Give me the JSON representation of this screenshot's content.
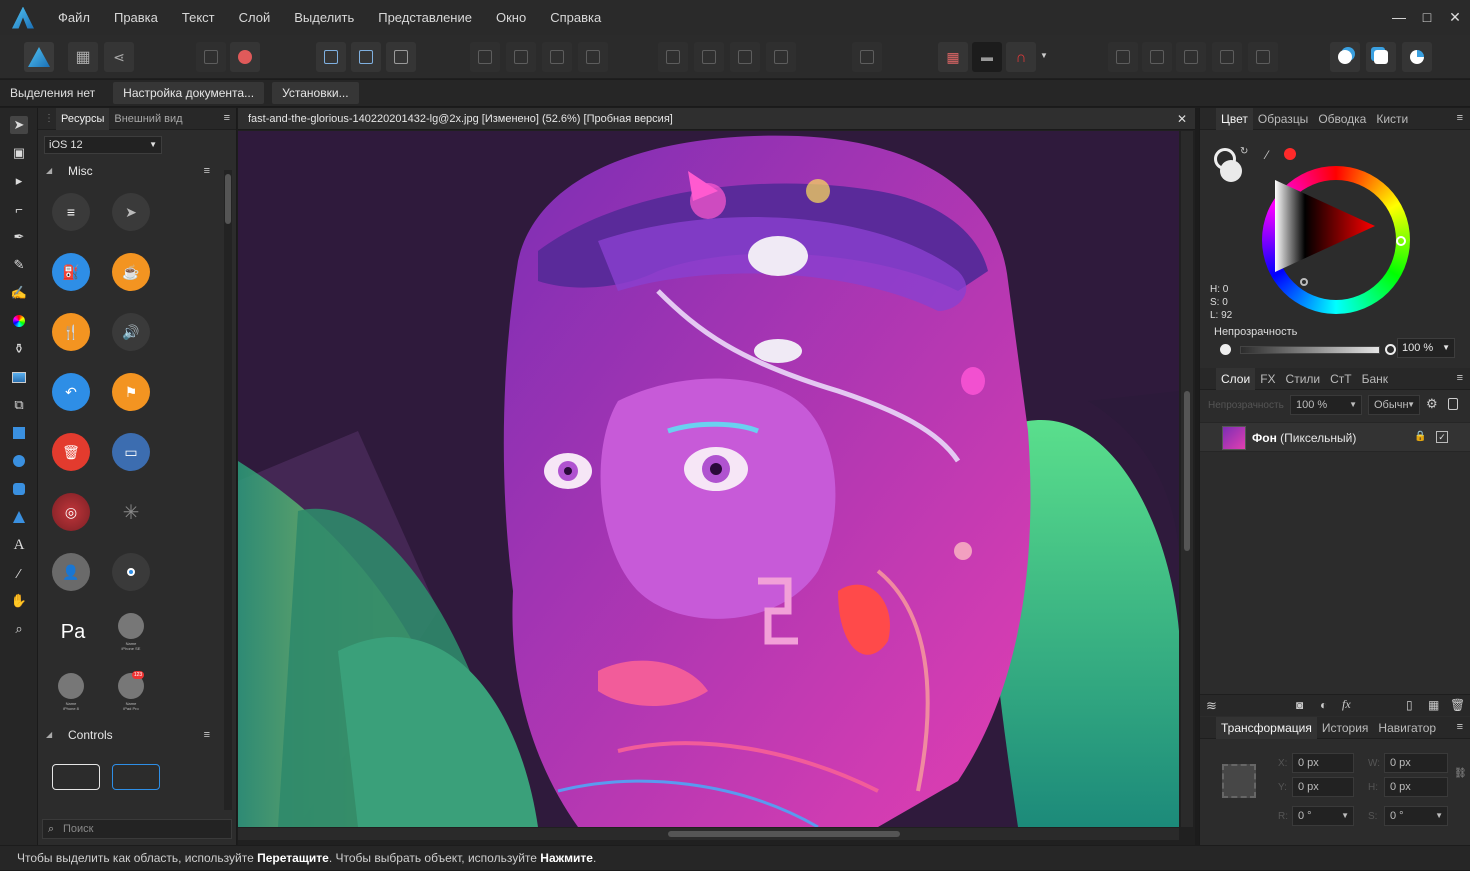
{
  "menu": [
    "Файл",
    "Правка",
    "Текст",
    "Слой",
    "Выделить",
    "Представление",
    "Окно",
    "Справка"
  ],
  "window_controls": {
    "minimize": "—",
    "maximize": "□",
    "close": "✕"
  },
  "context": {
    "selection": "Выделения нет",
    "doc_setup": "Настройка документа...",
    "preferences": "Установки..."
  },
  "resources": {
    "tabs": [
      "Ресурсы",
      "Внешний вид"
    ],
    "menu_icon": "≡",
    "set": "iOS 12",
    "section_misc": "Misc",
    "section_controls": "Controls",
    "search_placeholder": "Поиск",
    "apple_pay": "Pa",
    "device_labels": [
      "Name\niPhone SE",
      "Name\niPhone 8",
      "Name\niPad Pro"
    ],
    "badge": "123"
  },
  "document": {
    "title": "fast-and-the-glorious-140220201432-lg@2x.jpg [Изменено] (52.6%) [Пробная версия]",
    "close": "✕"
  },
  "color_panel": {
    "tabs": [
      "Цвет",
      "Образцы",
      "Обводка",
      "Кисти"
    ],
    "h": "H: 0",
    "s": "S: 0",
    "l": "L: 92",
    "opacity_label": "Непрозрачность",
    "opacity_value": "100 %",
    "accent": "#ff2a2a"
  },
  "layers_panel": {
    "tabs": [
      "Слои",
      "FX",
      "Стили",
      "СтТ",
      "Банк"
    ],
    "opacity_label": "Непрозрачность",
    "opacity_value": "100 %",
    "blend_mode": "Обычн",
    "layer_name": "Фон",
    "layer_type": "(Пиксельный)"
  },
  "transform_panel": {
    "tabs": [
      "Трансформация",
      "История",
      "Навигатор"
    ],
    "x": "0 px",
    "y": "0 px",
    "w": "0 px",
    "h": "0 px",
    "r": "0 °",
    "s": "0 °",
    "labels": [
      "X:",
      "Y:",
      "W:",
      "H:",
      "R:",
      "S:"
    ]
  },
  "status": {
    "part1": "Чтобы выделить как область, используйте ",
    "bold1": "Перетащите",
    "part2": ". Чтобы выбрать объект, используйте ",
    "bold2": "Нажмите",
    "part3": "."
  }
}
